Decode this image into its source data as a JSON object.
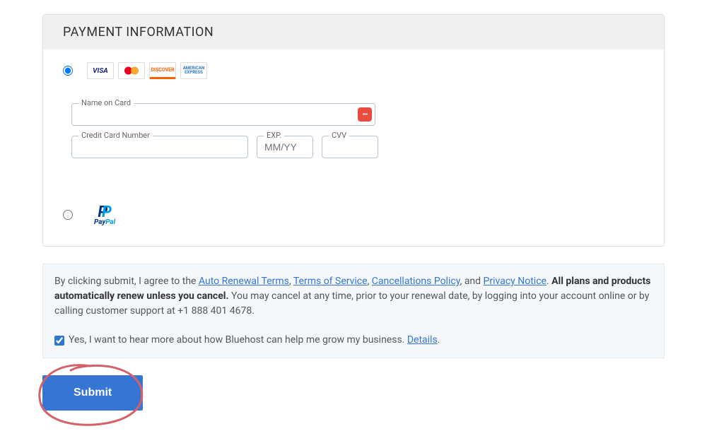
{
  "panel": {
    "title": "PAYMENT INFORMATION"
  },
  "payment_methods": {
    "card_brands": [
      "VISA",
      "",
      "DISCOVER",
      "AMERICAN EXPRESS"
    ],
    "paypal_label": "PayPal"
  },
  "fields": {
    "name_on_card": {
      "label": "Name on Card",
      "value": ""
    },
    "cc_number": {
      "label": "Credit Card Number",
      "value": ""
    },
    "exp": {
      "label": "EXP.",
      "placeholder": "MM/YY",
      "value": ""
    },
    "cvv": {
      "label": "CVV",
      "value": ""
    }
  },
  "terms": {
    "prefix": "By clicking submit, I agree to the ",
    "links": {
      "auto_renewal": "Auto Renewal Terms",
      "tos": "Terms of Service",
      "cancellations": "Cancellations Policy",
      "privacy": "Privacy Notice"
    },
    "and": ", and ",
    "period": ". ",
    "bold": "All plans and products automatically renew unless you cancel.",
    "body": " You may cancel at any time, prior to your renewal date, by logging into your account online or by calling customer support at +1 888 401 4678."
  },
  "optin": {
    "text": "Yes, I want to hear more about how Bluehost can help me grow my business. ",
    "details": "Details",
    "checked": true
  },
  "submit": {
    "label": "Submit"
  }
}
